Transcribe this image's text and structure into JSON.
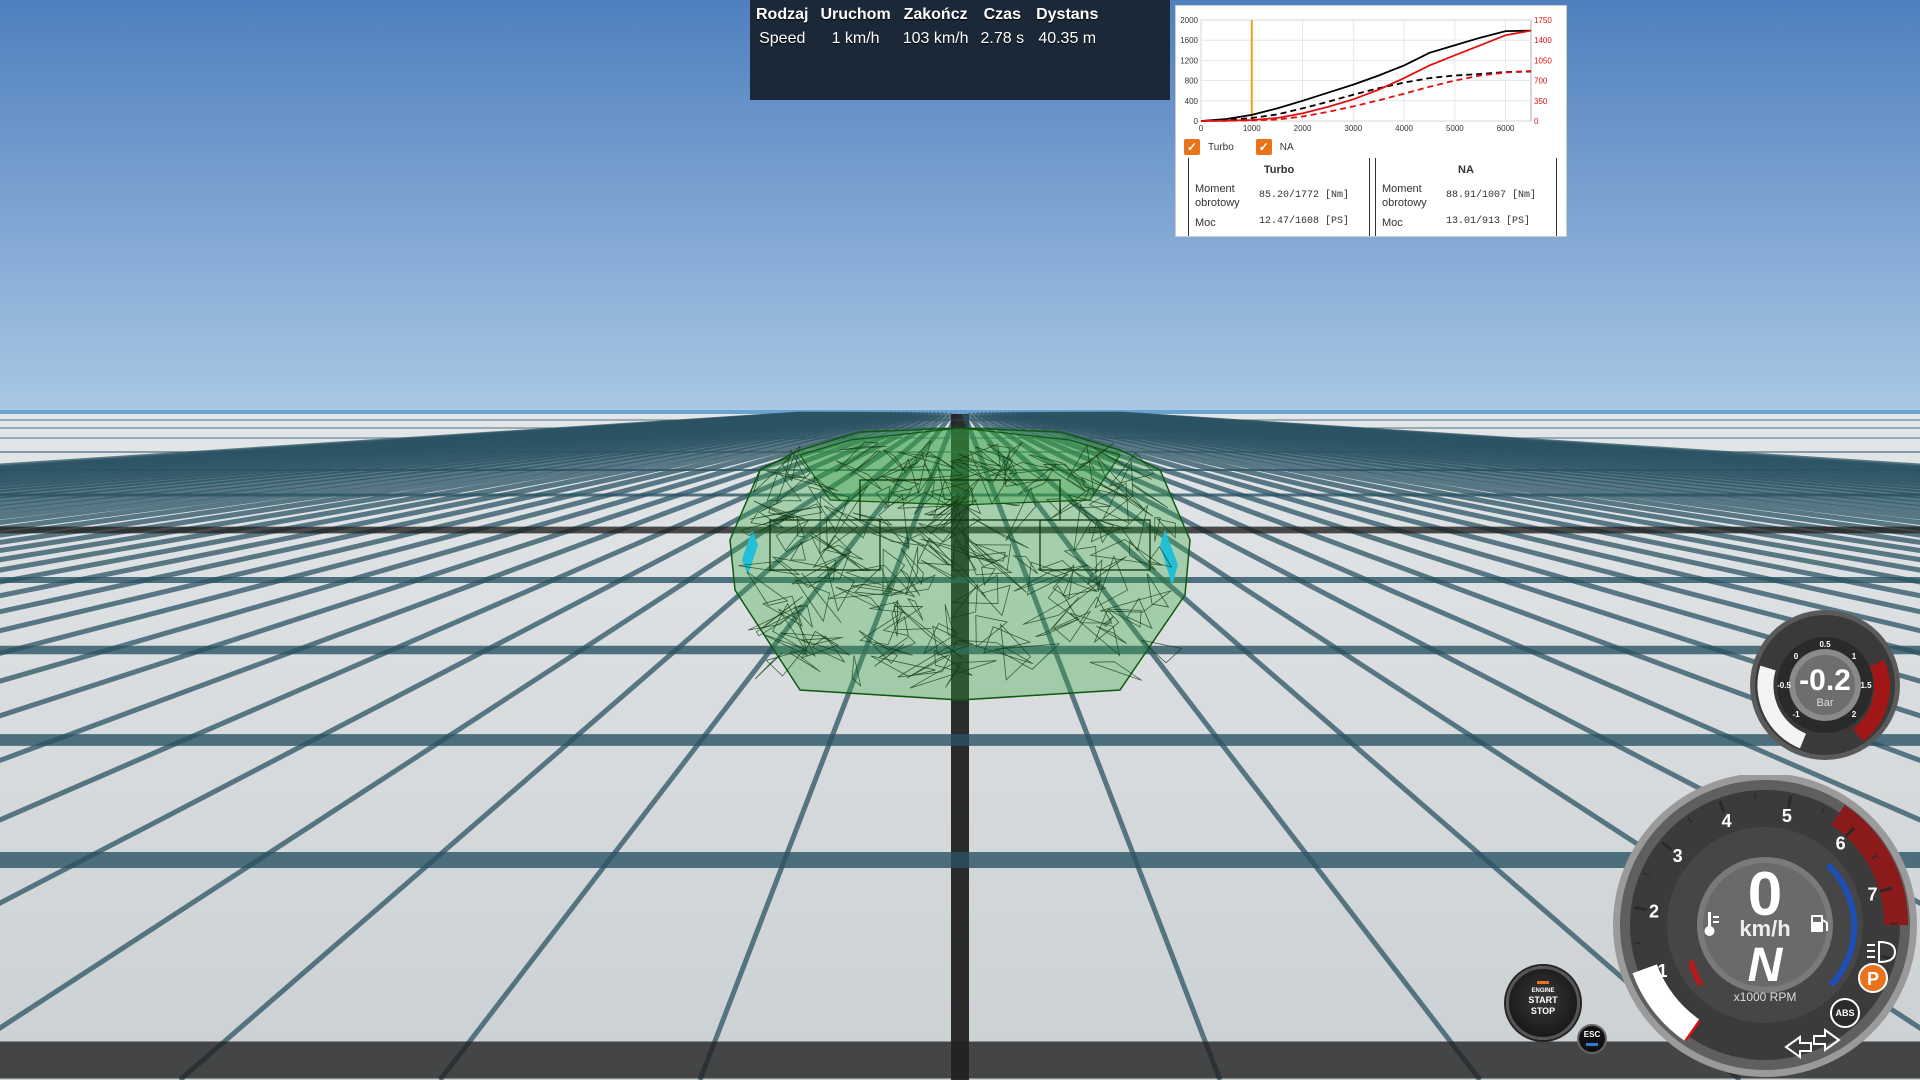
{
  "drag_results": {
    "headers": [
      "Rodzaj",
      "Uruchom",
      "Zakończ",
      "Czas",
      "Dystans"
    ],
    "row": [
      "Speed",
      "1 km/h",
      "103 km/h",
      "2.78 s",
      "40.35 m"
    ]
  },
  "dyno": {
    "legend": [
      "Turbo",
      "NA"
    ],
    "turbo": {
      "title": "Turbo",
      "torque_label": "Moment obrotowy",
      "torque_value": "85.20/1772 [Nm]",
      "power_label": "Moc",
      "power_value": "12.47/1608 [PS]"
    },
    "na": {
      "title": "NA",
      "torque_label": "Moment obrotowy",
      "torque_value": "88.91/1007 [Nm]",
      "power_label": "Moc",
      "power_value": "13.01/913 [PS]"
    }
  },
  "chart_data": {
    "type": "line",
    "title": "",
    "xlabel": "",
    "ylabel": "",
    "x_ticks": [
      "0",
      "1000",
      "2000",
      "3000",
      "4000",
      "5000",
      "6000"
    ],
    "left_ticks": [
      "0",
      "400",
      "800",
      "1200",
      "1600",
      "2000"
    ],
    "right_ticks": [
      "0",
      "350",
      "700",
      "1050",
      "1400",
      "1750"
    ],
    "xlim": [
      0,
      6500
    ],
    "ylim_left": [
      0,
      2000
    ],
    "ylim_right": [
      0,
      1750
    ],
    "marker_rpm": 1000,
    "series": [
      {
        "name": "Turbo",
        "color": "#000000",
        "dashed": false,
        "x": [
          0,
          500,
          1000,
          1500,
          2000,
          2500,
          3000,
          3500,
          4000,
          4500,
          5000,
          5500,
          6000,
          6500
        ],
        "y": [
          0,
          40,
          120,
          250,
          400,
          560,
          720,
          900,
          1100,
          1350,
          1500,
          1650,
          1780,
          1790
        ]
      },
      {
        "name": "Turbo",
        "color": "#000000",
        "dashed": true,
        "x": [
          0,
          500,
          1000,
          1500,
          2000,
          2500,
          3000,
          3500,
          4000,
          4500,
          5000,
          5500,
          6000,
          6500
        ],
        "y": [
          0,
          20,
          60,
          130,
          250,
          380,
          520,
          650,
          760,
          850,
          900,
          930,
          970,
          980
        ]
      },
      {
        "name": "NA",
        "color": "#e01010",
        "dashed": false,
        "x": [
          0,
          500,
          1000,
          1500,
          2000,
          2500,
          3000,
          3500,
          4000,
          4500,
          5000,
          5500,
          6000,
          6500
        ],
        "y": [
          0,
          5,
          20,
          60,
          150,
          280,
          430,
          620,
          850,
          1100,
          1300,
          1500,
          1700,
          1790
        ]
      },
      {
        "name": "NA",
        "color": "#e01010",
        "dashed": true,
        "x": [
          0,
          500,
          1000,
          1500,
          2000,
          2500,
          3000,
          3500,
          4000,
          4500,
          5000,
          5500,
          6000,
          6500
        ],
        "y": [
          0,
          3,
          10,
          30,
          90,
          180,
          290,
          410,
          540,
          680,
          800,
          900,
          960,
          990
        ]
      }
    ]
  },
  "boost_gauge": {
    "value": "-0.2",
    "unit": "Bar",
    "ticks": [
      "-1",
      "-0.5",
      "0",
      "0.5",
      "1",
      "1.5",
      "2"
    ]
  },
  "main_gauge": {
    "speed": "0",
    "speed_unit": "km/h",
    "gear": "N",
    "rpm_label": "x1000 RPM",
    "rpm_ticks": [
      "1",
      "2",
      "3",
      "4",
      "5",
      "6",
      "7"
    ],
    "rpm_fraction": 0.14
  },
  "indicators": {
    "parking": "P",
    "abs": "ABS",
    "esc": "ESC"
  },
  "start_stop": {
    "line1": "ENGINE",
    "line2": "START",
    "line3": "STOP"
  },
  "colors": {
    "sky_top": "#4f7fbf",
    "sky_bottom": "#a9c8e4",
    "ground": "#d8dcde",
    "grid_line": "#1f4a5a",
    "car_wire": "#0f5a0f",
    "accent_orange": "#e8731b",
    "gauge_red": "#a11616",
    "gauge_blue": "#1d4fb6"
  }
}
